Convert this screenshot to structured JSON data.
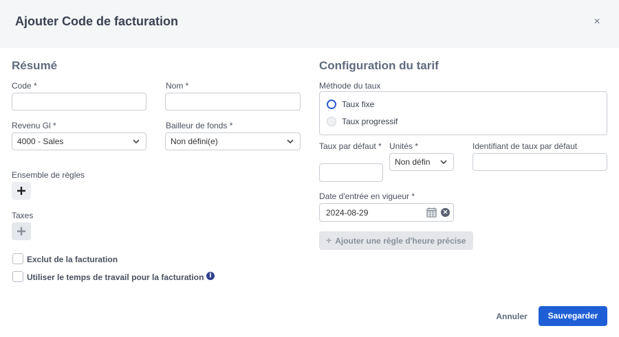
{
  "dialog": {
    "title": "Ajouter Code de facturation",
    "close_label": "×"
  },
  "summary": {
    "title": "Résumé",
    "code_label": "Code *",
    "code_value": "",
    "name_label": "Nom *",
    "name_value": "",
    "gl_label": "Revenu Gl *",
    "gl_value": "4000 - Sales",
    "funder_label": "Bailleur de fonds *",
    "funder_value": "Non défini(e)",
    "ruleset_label": "Ensemble de règles",
    "taxes_label": "Taxes",
    "exclude_label": "Exclut de la facturation",
    "exclude_checked": false,
    "worktime_label": "Utiliser le temps de travail pour la facturation",
    "worktime_checked": false,
    "info_glyph": "i"
  },
  "rate": {
    "title": "Configuration du tarif",
    "method_label": "Méthode du taux",
    "options": [
      {
        "label": "Taux fixe",
        "selected": true
      },
      {
        "label": "Taux progressif",
        "selected": false
      }
    ],
    "default_rate_label": "Taux par défaut *",
    "default_rate_value": "",
    "units_label": "Unités *",
    "units_value": "Non défin",
    "default_id_label": "Identifiant de taux par défaut",
    "default_id_value": "",
    "effective_date_label": "Date d'entrée en vigueur *",
    "effective_date_value": "2024-08-29",
    "add_rule_label": "Ajouter une règle d'heure précise"
  },
  "footer": {
    "cancel_label": "Annuler",
    "save_label": "Sauvegarder"
  },
  "colors": {
    "primary": "#1f5fd6",
    "header_bg": "#f5f6f8",
    "info_icon": "#2f3f8f"
  },
  "icons": [
    "close-icon",
    "chevron-down-icon",
    "plus-icon",
    "info-icon",
    "calendar-icon",
    "clear-icon"
  ]
}
